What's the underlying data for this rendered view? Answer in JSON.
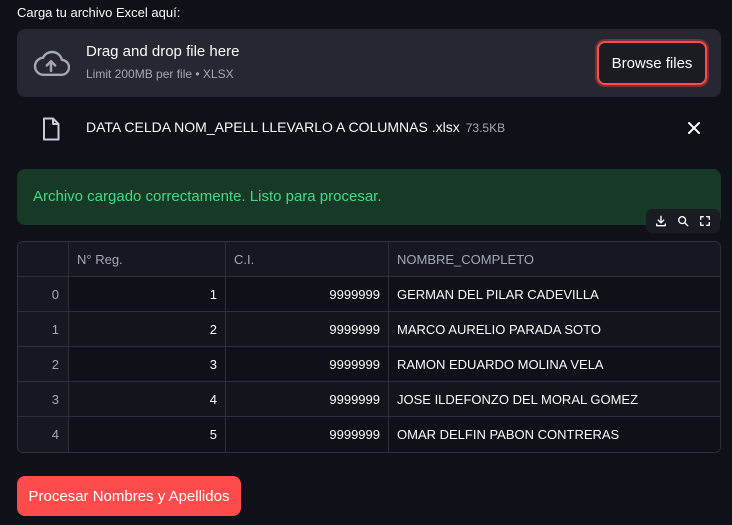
{
  "uploader": {
    "label": "Carga tu archivo Excel aquí:",
    "title": "Drag and drop file here",
    "subtitle": "Limit 200MB per file • XLSX",
    "browse_label": "Browse files"
  },
  "file": {
    "name": "DATA CELDA NOM_APELL LLEVARLO A COLUMNAS .xlsx",
    "size": "73.5KB"
  },
  "alert": {
    "message": "Archivo cargado correctamente. Listo para procesar."
  },
  "toolbar": {
    "icons": [
      "download-icon",
      "search-icon",
      "fullscreen-icon"
    ]
  },
  "table": {
    "columns": [
      "",
      "N° Reg.",
      "C.I.",
      "NOMBRE_COMPLETO"
    ],
    "rows": [
      [
        "0",
        "1",
        "9999999",
        "GERMAN DEL PILAR CADEVILLA"
      ],
      [
        "1",
        "2",
        "9999999",
        "MARCO AURELIO PARADA SOTO"
      ],
      [
        "2",
        "3",
        "9999999",
        "RAMON EDUARDO MOLINA VELA"
      ],
      [
        "3",
        "4",
        "9999999",
        "JOSE ILDEFONZO DEL MORAL GOMEZ"
      ],
      [
        "4",
        "5",
        "9999999",
        "OMAR DELFIN PABON CONTRERAS"
      ]
    ]
  },
  "actions": {
    "process_label": "Procesar Nombres y Apellidos"
  },
  "colors": {
    "background": "#0e1117",
    "accent": "#ff4b4b",
    "success_bg": "#173928",
    "success_text": "#3ddc84"
  }
}
